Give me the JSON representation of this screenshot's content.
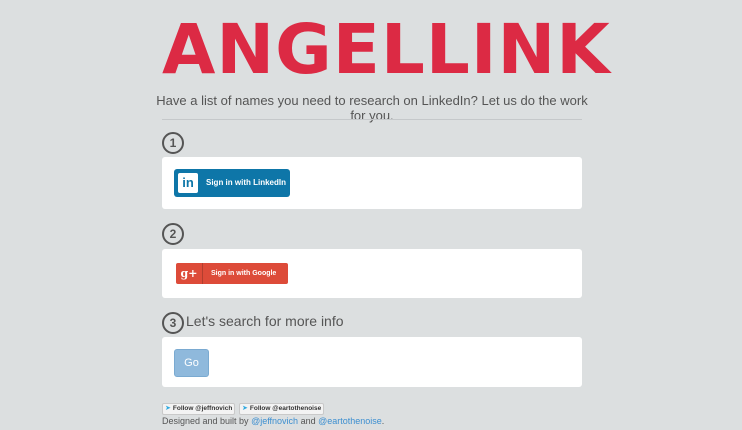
{
  "header": {
    "logo_text": "ANGELLINK",
    "tagline": "Have a list of names you need to research on LinkedIn? Let us do the work for you."
  },
  "steps": [
    {
      "number": "1",
      "title": "",
      "button_label": "Sign in with LinkedIn",
      "icon_text": "in",
      "icon": "linkedin-icon"
    },
    {
      "number": "2",
      "title": "",
      "button_label": "Sign in with Google",
      "icon_text": "g+",
      "icon": "google-plus-icon"
    },
    {
      "number": "3",
      "title": "Let's search for more info",
      "button_label": "Go"
    }
  ],
  "footer": {
    "follow_buttons": [
      "Follow @jeffnovich",
      "Follow @eartothenoise"
    ],
    "credit_prefix": "Designed and built by ",
    "author1": "@jeffnovich",
    "and": " and ",
    "author2": "@eartothenoise",
    "suffix": "."
  },
  "colors": {
    "background": "#dcdfe0",
    "logo": "#dc2a44",
    "linkedin": "#0e76a8",
    "google": "#dd4b39",
    "go_button": "#8fb9dc",
    "link": "#3d8fd0"
  }
}
